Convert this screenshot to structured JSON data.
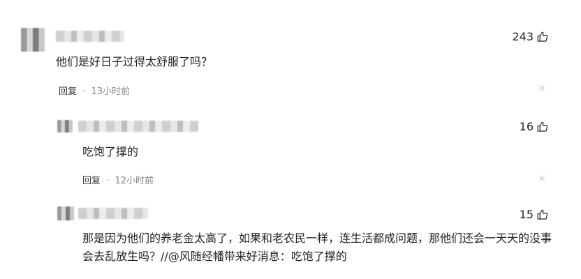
{
  "comments": [
    {
      "likes": "243",
      "text": "他们是好日子过得太舒服了吗？",
      "reply_label": "回复",
      "separator": "·",
      "time": "13小时前",
      "close": "×"
    },
    {
      "likes": "16",
      "text": "吃饱了撑的",
      "reply_label": "回复",
      "separator": "·",
      "time": "12小时前",
      "close": "×"
    },
    {
      "likes": "15",
      "text": "那是因为他们的养老金太高了，如果和老农民一样，连生活都成问题，那他们还会一天天的没事会去乱放生吗？//@风随经幡带来好消息：吃饱了撑的"
    }
  ],
  "icons": {
    "like": "thumbs-up-icon",
    "close": "close-icon"
  }
}
